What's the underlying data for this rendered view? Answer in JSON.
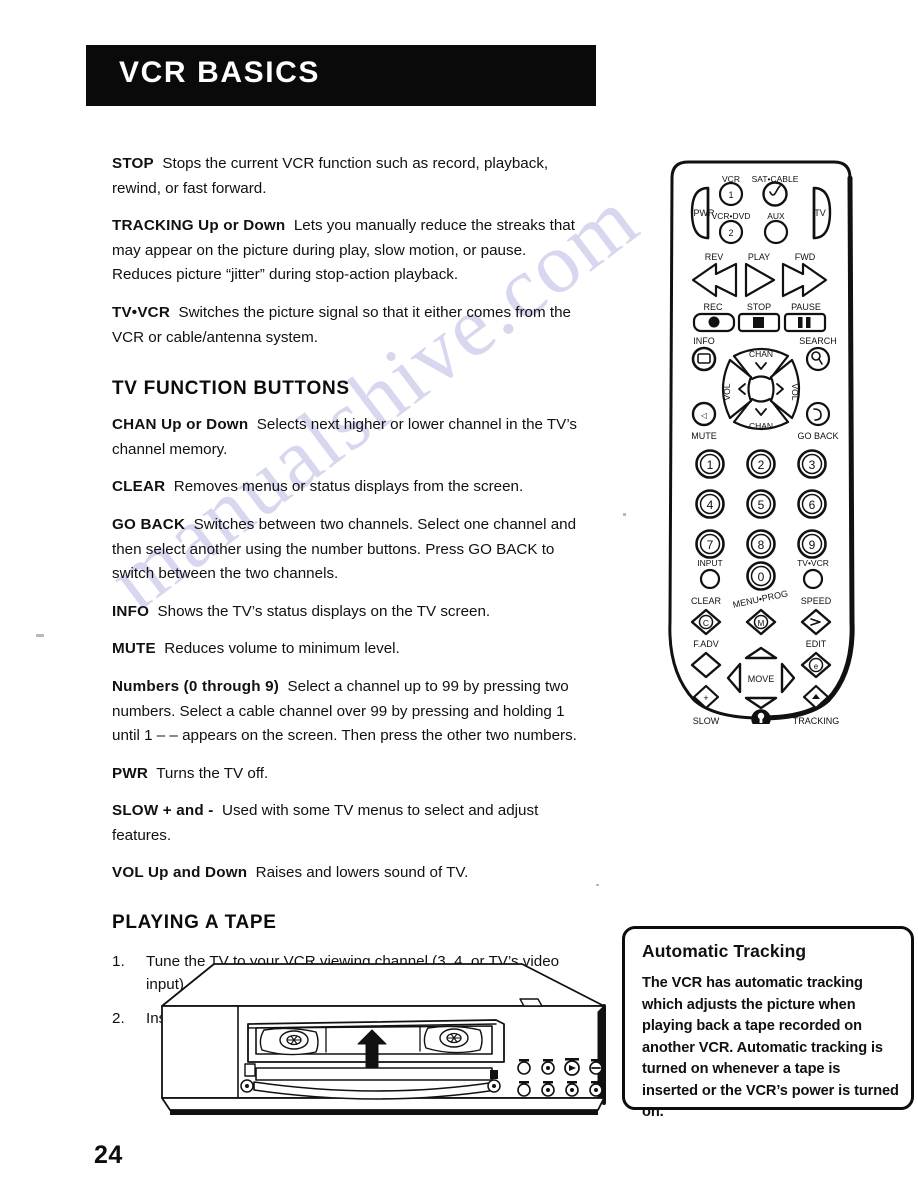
{
  "page": {
    "header_title": "VCR BASICS",
    "page_number": "24",
    "watermark": "manualshive.com"
  },
  "body": {
    "entries": [
      {
        "term": "STOP",
        "text": "Stops the current VCR function such as record, playback, rewind, or fast forward."
      },
      {
        "term": "TRACKING Up or Down",
        "text": "Lets you manually reduce the streaks that may appear on the picture during play, slow motion, or pause. Reduces picture “jitter” during stop-action playback."
      },
      {
        "term": "TV•VCR",
        "text": "Switches the picture signal so that it either comes from the VCR or cable/antenna system."
      }
    ],
    "tv_function_heading": "TV FUNCTION BUTTONS",
    "tv_entries": [
      {
        "term": "CHAN Up or Down",
        "text": "Selects next higher or lower channel in the TV’s channel memory."
      },
      {
        "term": "CLEAR",
        "text": "Removes menus or status displays from the screen."
      },
      {
        "term": "GO BACK",
        "text": "Switches between two channels. Select one channel and then select another using the number buttons. Press GO BACK to switch between the two channels."
      },
      {
        "term": "INFO",
        "text": "Shows the TV’s status displays on the TV screen."
      },
      {
        "term": "MUTE",
        "text": "Reduces volume to minimum level."
      },
      {
        "term": "Numbers (0 through 9)",
        "text": "Select a channel up to 99 by pressing two numbers. Select a cable channel over 99 by pressing and holding 1 until 1 – – appears on the screen. Then press the other two numbers."
      },
      {
        "term": "PWR",
        "text": "Turns the TV off."
      },
      {
        "term": "SLOW + and -",
        "text": "Used with some TV menus to select and adjust features."
      },
      {
        "term": "VOL Up and Down",
        "text": "Raises and lowers sound of TV."
      }
    ],
    "playing_heading": "PLAYING A TAPE",
    "steps": [
      {
        "num": "1.",
        "text": "Tune the TV to your VCR viewing channel (3, 4, or TV’s video input)."
      },
      {
        "num": "2.",
        "text": "Insert a tape in the VCR."
      }
    ]
  },
  "callout": {
    "title": "Automatic Tracking",
    "body": "The VCR has automatic tracking which adjusts the picture when playing back a tape recorded on another VCR. Automatic tracking is turned on whenever a tape is inserted or the VCR’s power is turned on."
  },
  "remote": {
    "labels": {
      "vcr": "VCR",
      "sat_cable": "SAT•CABLE",
      "pwr": "PWR",
      "vcr_dvd": "VCR•DVD",
      "aux": "AUX",
      "tv": "TV",
      "rev": "REV",
      "play": "PLAY",
      "fwd": "FWD",
      "rec": "REC",
      "stop": "STOP",
      "pause": "PAUSE",
      "info": "INFO",
      "search": "SEARCH",
      "chan_up": "CHAN",
      "chan_down": "CHAN",
      "vol_left": "VOL",
      "vol_right": "VOL",
      "mute": "MUTE",
      "go_back": "GO BACK",
      "input": "INPUT",
      "tv_vcr": "TV•VCR",
      "clear": "CLEAR",
      "menu_prog": "MENU•PROG",
      "speed": "SPEED",
      "f_adv": "F.ADV",
      "edit": "EDIT",
      "move": "MOVE",
      "slow": "SLOW",
      "tracking": "TRACKING",
      "device_1": "1",
      "device_2": "2"
    },
    "keypad": [
      "1",
      "2",
      "3",
      "4",
      "5",
      "6",
      "7",
      "8",
      "9",
      "0"
    ]
  },
  "colors": {
    "ink": "#101010",
    "paper": "#ffffff",
    "banner": "#0a0a0a",
    "watermark": "#c9c8ea"
  }
}
